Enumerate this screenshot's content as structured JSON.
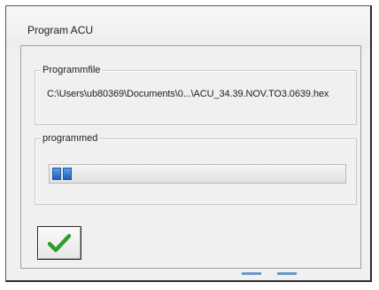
{
  "window": {
    "title": "Program ACU"
  },
  "programmfile_group": {
    "legend": "Programmfile",
    "path": "C:\\Users\\ub80369\\Documents\\0...\\ACU_34.39.NOV.TO3.0639.hex"
  },
  "progress_group": {
    "legend": "programmed",
    "progress_fraction": 0.05
  },
  "ok_button": {
    "icon": "checkmark-icon",
    "icon_color": "#2e9e2e"
  },
  "colors": {
    "progress_fill": "#2f74d0",
    "window_bg": "#f0f0f0"
  }
}
